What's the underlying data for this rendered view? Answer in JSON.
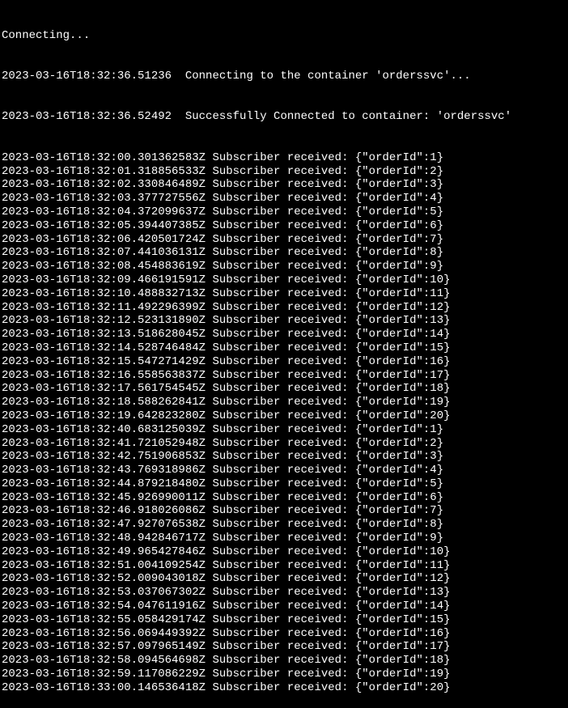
{
  "terminal": {
    "connecting": "Connecting...",
    "connect_line": "2023-03-16T18:32:36.51236  Connecting to the container 'orderssvc'...",
    "success_line": "2023-03-16T18:32:36.52492  Successfully Connected to container: 'orderssvc'",
    "logs": [
      "2023-03-16T18:32:00.301362583Z Subscriber received: {\"orderId\":1}",
      "2023-03-16T18:32:01.318856533Z Subscriber received: {\"orderId\":2}",
      "2023-03-16T18:32:02.330846489Z Subscriber received: {\"orderId\":3}",
      "2023-03-16T18:32:03.377727556Z Subscriber received: {\"orderId\":4}",
      "2023-03-16T18:32:04.372099637Z Subscriber received: {\"orderId\":5}",
      "2023-03-16T18:32:05.394407385Z Subscriber received: {\"orderId\":6}",
      "2023-03-16T18:32:06.420501724Z Subscriber received: {\"orderId\":7}",
      "2023-03-16T18:32:07.441036131Z Subscriber received: {\"orderId\":8}",
      "2023-03-16T18:32:08.454883619Z Subscriber received: {\"orderId\":9}",
      "2023-03-16T18:32:09.466191591Z Subscriber received: {\"orderId\":10}",
      "2023-03-16T18:32:10.488832713Z Subscriber received: {\"orderId\":11}",
      "2023-03-16T18:32:11.492296399Z Subscriber received: {\"orderId\":12}",
      "2023-03-16T18:32:12.523131890Z Subscriber received: {\"orderId\":13}",
      "2023-03-16T18:32:13.518628045Z Subscriber received: {\"orderId\":14}",
      "2023-03-16T18:32:14.528746484Z Subscriber received: {\"orderId\":15}",
      "2023-03-16T18:32:15.547271429Z Subscriber received: {\"orderId\":16}",
      "2023-03-16T18:32:16.558563837Z Subscriber received: {\"orderId\":17}",
      "2023-03-16T18:32:17.561754545Z Subscriber received: {\"orderId\":18}",
      "2023-03-16T18:32:18.588262841Z Subscriber received: {\"orderId\":19}",
      "2023-03-16T18:32:19.642823280Z Subscriber received: {\"orderId\":20}",
      "2023-03-16T18:32:40.683125039Z Subscriber received: {\"orderId\":1}",
      "2023-03-16T18:32:41.721052948Z Subscriber received: {\"orderId\":2}",
      "2023-03-16T18:32:42.751906853Z Subscriber received: {\"orderId\":3}",
      "2023-03-16T18:32:43.769318986Z Subscriber received: {\"orderId\":4}",
      "2023-03-16T18:32:44.879218480Z Subscriber received: {\"orderId\":5}",
      "2023-03-16T18:32:45.926990011Z Subscriber received: {\"orderId\":6}",
      "2023-03-16T18:32:46.918026086Z Subscriber received: {\"orderId\":7}",
      "2023-03-16T18:32:47.927076538Z Subscriber received: {\"orderId\":8}",
      "2023-03-16T18:32:48.942846717Z Subscriber received: {\"orderId\":9}",
      "2023-03-16T18:32:49.965427846Z Subscriber received: {\"orderId\":10}",
      "2023-03-16T18:32:51.004109254Z Subscriber received: {\"orderId\":11}",
      "2023-03-16T18:32:52.009043018Z Subscriber received: {\"orderId\":12}",
      "2023-03-16T18:32:53.037067302Z Subscriber received: {\"orderId\":13}",
      "2023-03-16T18:32:54.047611916Z Subscriber received: {\"orderId\":14}",
      "2023-03-16T18:32:55.058429174Z Subscriber received: {\"orderId\":15}",
      "2023-03-16T18:32:56.069449392Z Subscriber received: {\"orderId\":16}",
      "2023-03-16T18:32:57.097965149Z Subscriber received: {\"orderId\":17}",
      "2023-03-16T18:32:58.094564698Z Subscriber received: {\"orderId\":18}",
      "2023-03-16T18:32:59.117086229Z Subscriber received: {\"orderId\":19}",
      "2023-03-16T18:33:00.146536418Z Subscriber received: {\"orderId\":20}"
    ]
  }
}
